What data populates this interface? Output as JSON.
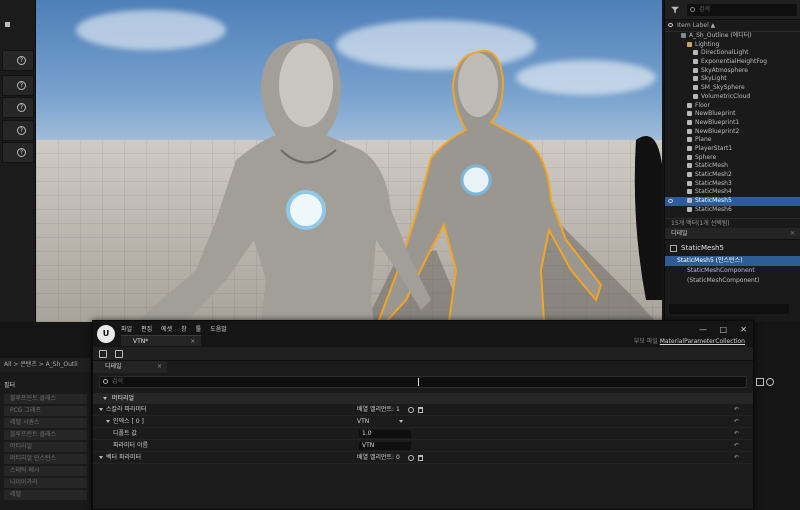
{
  "viewport": {},
  "outliner": {
    "search_placeholder": "검색",
    "header_label": "Item Label ▲",
    "items": [
      {
        "label": "A_Sh_Outline (에디터)",
        "indent": 1,
        "icon": "world-icon",
        "color": "#7d8b9b"
      },
      {
        "label": "Lighting",
        "indent": 2,
        "icon": "folder-icon",
        "color": "#c9a45b"
      },
      {
        "label": "DirectionalLight",
        "indent": 3,
        "icon": "light-icon",
        "color": "#b8b8b8"
      },
      {
        "label": "ExponentialHeightFog",
        "indent": 3,
        "icon": "fog-icon",
        "color": "#b8b8b8"
      },
      {
        "label": "SkyAtmosphere",
        "indent": 3,
        "icon": "sky-icon",
        "color": "#b8b8b8"
      },
      {
        "label": "SkyLight",
        "indent": 3,
        "icon": "light-icon",
        "color": "#b8b8b8"
      },
      {
        "label": "SM_SkySphere",
        "indent": 3,
        "icon": "mesh-icon",
        "color": "#b8b8b8"
      },
      {
        "label": "VolumetricCloud",
        "indent": 3,
        "icon": "cloud-icon",
        "color": "#b8b8b8"
      },
      {
        "label": "Floor",
        "indent": 2,
        "icon": "mesh-icon",
        "color": "#b8b8b8"
      },
      {
        "label": "NewBlueprint",
        "indent": 2,
        "icon": "blueprint-icon",
        "color": "#b8b8b8"
      },
      {
        "label": "NewBlueprint1",
        "indent": 2,
        "icon": "blueprint-icon",
        "color": "#b8b8b8"
      },
      {
        "label": "NewBlueprint2",
        "indent": 2,
        "icon": "blueprint-icon",
        "color": "#b8b8b8"
      },
      {
        "label": "Plane",
        "indent": 2,
        "icon": "mesh-icon",
        "color": "#b8b8b8"
      },
      {
        "label": "PlayerStart1",
        "indent": 2,
        "icon": "player-start-icon",
        "color": "#b8b8b8"
      },
      {
        "label": "Sphere",
        "indent": 2,
        "icon": "mesh-icon",
        "color": "#b8b8b8"
      },
      {
        "label": "StaticMesh",
        "indent": 2,
        "icon": "mesh-icon",
        "color": "#b8b8b8"
      },
      {
        "label": "StaticMesh2",
        "indent": 2,
        "icon": "mesh-icon",
        "color": "#b8b8b8"
      },
      {
        "label": "StaticMesh3",
        "indent": 2,
        "icon": "mesh-icon",
        "color": "#b8b8b8"
      },
      {
        "label": "StaticMesh4",
        "indent": 2,
        "icon": "mesh-icon",
        "color": "#b8b8b8"
      },
      {
        "label": "StaticMesh5",
        "indent": 2,
        "icon": "mesh-icon",
        "color": "#b8b8b8",
        "selected": true
      },
      {
        "label": "StaticMesh6",
        "indent": 2,
        "icon": "mesh-icon",
        "color": "#b8b8b8"
      }
    ],
    "count_label": "15개 액터(1개 선택됨)"
  },
  "details": {
    "tab_label": "디테일",
    "object_name": "StaticMesh5",
    "selected_component": "StaticMesh5 (인스턴스)",
    "component": "StaticMeshComponent (StaticMeshComponent)"
  },
  "content_browser": {
    "breadcrumb": "All > 콘텐츠 > A_Sh_Outli",
    "filter_title": "필터",
    "items": [
      "블루프린트 클래스",
      "PCG 그래프",
      "레벨 시퀀스",
      "블루프린트 클래스",
      "머티리얼",
      "머티리얼 인스턴스",
      "스태틱 메시",
      "나이아가라",
      "레벨"
    ]
  },
  "mp_editor": {
    "menu": [
      "파일",
      "편집",
      "에셋",
      "창",
      "툴",
      "도움말"
    ],
    "asset_tab": "VTN*",
    "parent_label_prefix": "부모 파일",
    "parent_label": "MaterialParameterCollection",
    "panel_tab": "디테일",
    "search_placeholder": "검색",
    "category": "머티리얼",
    "rows": [
      {
        "name": "스칼라 파라미터",
        "value": "배열 엘리먼트: 1",
        "indent": 0,
        "kind": "array"
      },
      {
        "name": "인덱스 [ 0 ]",
        "value": "VTN",
        "indent": 1,
        "kind": "dropdown"
      },
      {
        "name": "디폴트 값",
        "value": "1.0",
        "indent": 2,
        "kind": "input"
      },
      {
        "name": "파라미터 이름",
        "value": "VTN",
        "indent": 2,
        "kind": "input"
      },
      {
        "name": "벡터 파라미터",
        "value": "배열 엘리먼트: 0",
        "indent": 0,
        "kind": "array"
      }
    ]
  }
}
